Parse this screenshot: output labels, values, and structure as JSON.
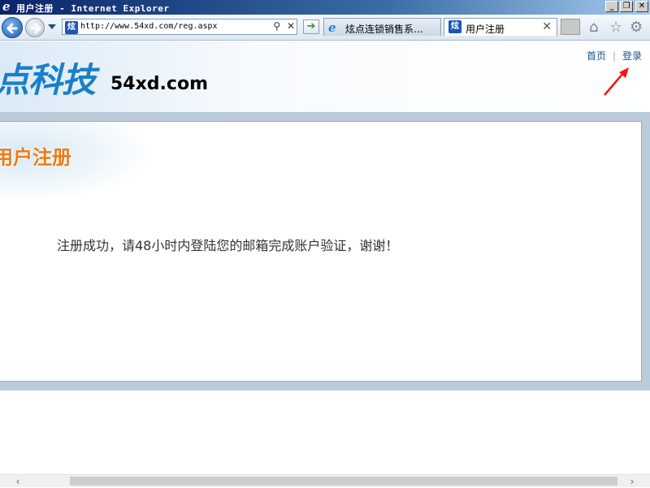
{
  "window": {
    "title": "用户注册 - Internet Explorer",
    "logo_glyph": "e",
    "minimize": "_",
    "restore": "❐",
    "close": "✕"
  },
  "navbar": {
    "address": "http://www.54xd.com/reg.aspx",
    "favicon_text": "炫",
    "search_glyph": "⚲",
    "refresh_glyph": "✕",
    "go_glyph": "➔",
    "tabs": [
      {
        "label": "炫点连锁销售系...",
        "icon": "ie-icon",
        "active": false
      },
      {
        "label": "用户注册",
        "icon": "xd-favicon",
        "active": true,
        "close": "✕"
      }
    ],
    "tools": {
      "home": "⌂",
      "favorites": "☆",
      "settings": "⚙"
    }
  },
  "header": {
    "brand_cn": "点科技",
    "brand_en": "54xd.com",
    "links": {
      "home": "首页",
      "login": "登录"
    },
    "accent_color": "#1a7fc6"
  },
  "content": {
    "section_title": "用户注册",
    "message": "注册成功，请48小时内登陆您的邮箱完成账户验证，谢谢！",
    "title_color": "#f07a14"
  },
  "scrollbar": {
    "left": "‹",
    "right": "›"
  }
}
